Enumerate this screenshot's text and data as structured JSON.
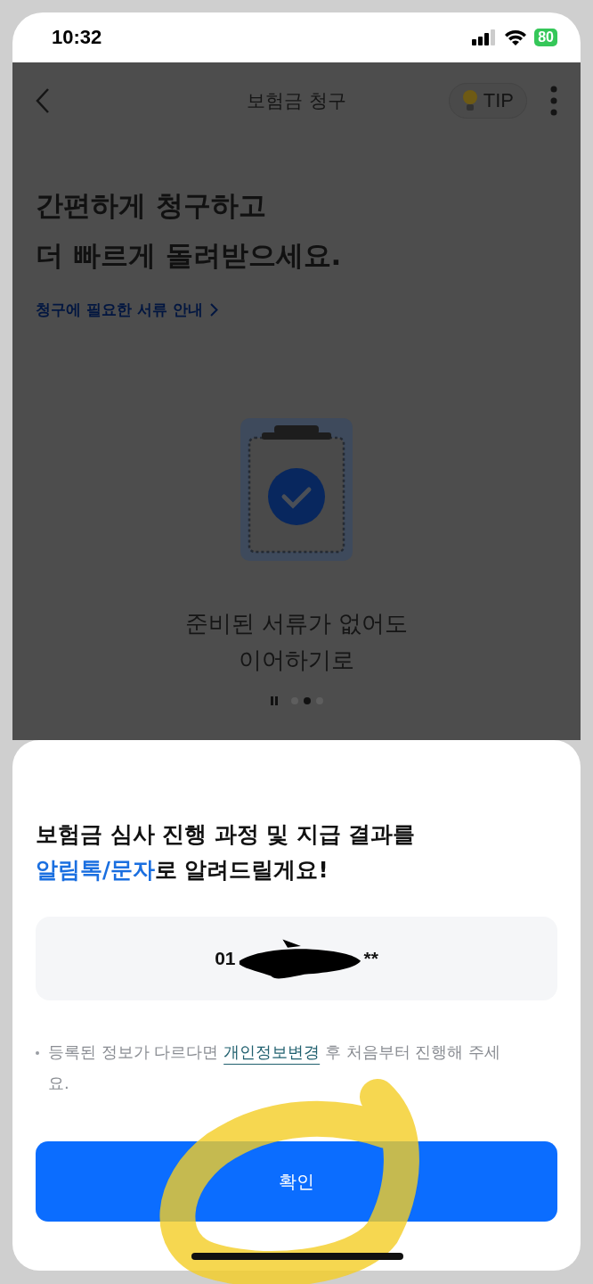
{
  "status_bar": {
    "time": "10:32",
    "battery": "80"
  },
  "header": {
    "title": "보험금 청구",
    "tip": "TIP"
  },
  "hero": {
    "headline": [
      "간편하게 청구하고",
      "더 빠르게 돌려받으세요."
    ],
    "docs_link": "청구에 필요한 서류 안내",
    "caption": [
      "준비된 서류가 없어도",
      "이어하기로"
    ]
  },
  "carousel_dots": [
    {
      "selected": false
    },
    {
      "selected": true
    },
    {
      "selected": false
    }
  ],
  "sheet": {
    "title": [
      "보험금 심사 진행 과정 및 지급 결과를",
      "**알림톡/문자**로 알려드릴게요!"
    ],
    "phone": {
      "start": "01",
      "end": "**"
    },
    "note": {
      "before": "등록된 정보가 다르다면",
      "link": "개인정보변경",
      "after": "후 처음부터 진행해 주세요."
    },
    "confirm": "확인"
  }
}
